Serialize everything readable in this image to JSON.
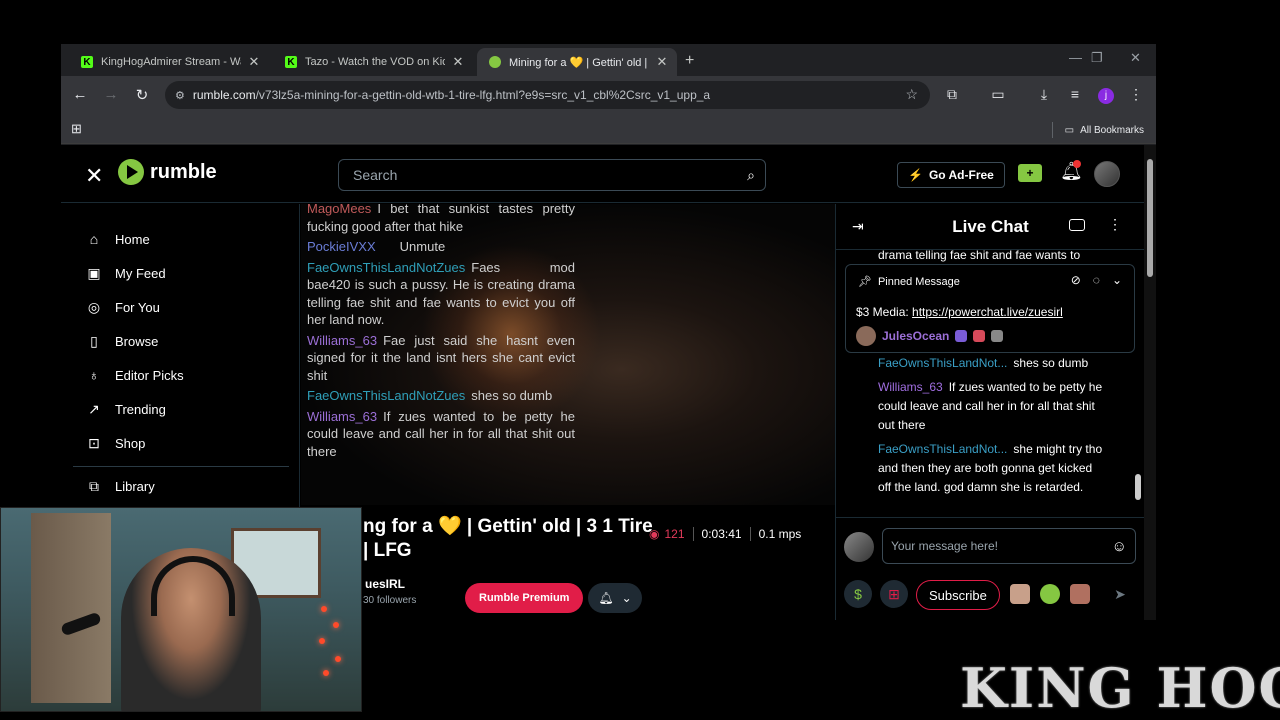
{
  "browser": {
    "tabs": [
      {
        "title": "KingHogAdmirer Stream - Watc",
        "favicon": "kick"
      },
      {
        "title": "Tazo - Watch the VOD on Kick",
        "favicon": "kick"
      },
      {
        "title": "Mining for a 💛 | Gettin' old | W",
        "favicon": "rumble",
        "active": true
      }
    ],
    "url_host": "rumble.com",
    "url_path": "/v73lz5a-mining-for-a-gettin-old-wtb-1-tire-lfg.html?e9s=src_v1_cbl%2Csrc_v1_upp_a",
    "profile_initial": "j",
    "all_bookmarks": "All Bookmarks"
  },
  "header": {
    "brand": "rumble",
    "search_placeholder": "Search",
    "go_ad_free": "Go Ad-Free"
  },
  "sidebar": {
    "items": [
      {
        "label": "Home",
        "icon": "home-icon"
      },
      {
        "label": "My Feed",
        "icon": "feed-icon"
      },
      {
        "label": "For You",
        "icon": "for-you-icon"
      },
      {
        "label": "Browse",
        "icon": "browse-icon"
      },
      {
        "label": "Editor Picks",
        "icon": "award-icon"
      },
      {
        "label": "Trending",
        "icon": "trending-icon"
      },
      {
        "label": "Shop",
        "icon": "shop-icon"
      },
      {
        "label": "Library",
        "icon": "library-icon"
      }
    ]
  },
  "video_overlay_chat": [
    {
      "user": "MagoMees",
      "text": "I bet that sunkist tastes pretty fucking good after that hike",
      "color": "red"
    },
    {
      "user": "PockieIVXX",
      "text": "Unmute",
      "color": "blue"
    },
    {
      "user": "FaeOwnsThisLandNotZues",
      "text": "Faes mod bae420 is such a pussy. He is creating drama telling fae shit and fae wants to evict you off her land now.",
      "color": "green"
    },
    {
      "user": "Williams_63",
      "text": "Fae just said she hasnt even signed for it the land isnt hers she cant evict shit",
      "color": "purple"
    },
    {
      "user": "FaeOwnsThisLandNotZues",
      "text": "shes so dumb",
      "color": "green"
    },
    {
      "user": "Williams_63",
      "text": "If zues wanted to be petty he could leave and call her in for all that shit out there",
      "color": "purple"
    }
  ],
  "video_info": {
    "title": "ng for a 💛 | Gettin' old | 3 1 Tire | LFG",
    "views": "121",
    "duration": "0:03:41",
    "speed": "0.1 mps",
    "channel": "uesIRL",
    "followers": "30 followers",
    "premium_label": "Rumble Premium"
  },
  "chat": {
    "title": "Live Chat",
    "top_fragment": "drama telling fae shit and fae wants to",
    "pinned_label": "Pinned Message",
    "pinned_text": "$3 Media:",
    "pinned_link": "https://powerchat.live/zuesirl",
    "pinned_user": "JulesOcean",
    "messages": [
      {
        "user": "FaeOwnsThisLandNot...",
        "text": "shes so dumb",
        "color": "#3a9fc6"
      },
      {
        "user": "Williams_63",
        "text": "If zues wanted to be petty he could leave and call her in for all that shit out there",
        "color": "#a06ee0"
      },
      {
        "user": "FaeOwnsThisLandNot...",
        "text": "she might try tho and then they are both gonna get kicked off the land. god damn she is retarded.",
        "color": "#3a9fc6"
      }
    ],
    "input_placeholder": "Your message here!",
    "subscribe_label": "Subscribe"
  },
  "watermark": "KING HOG",
  "colors": {
    "rumble_green": "#85c742",
    "premium_red": "#e11d48"
  }
}
